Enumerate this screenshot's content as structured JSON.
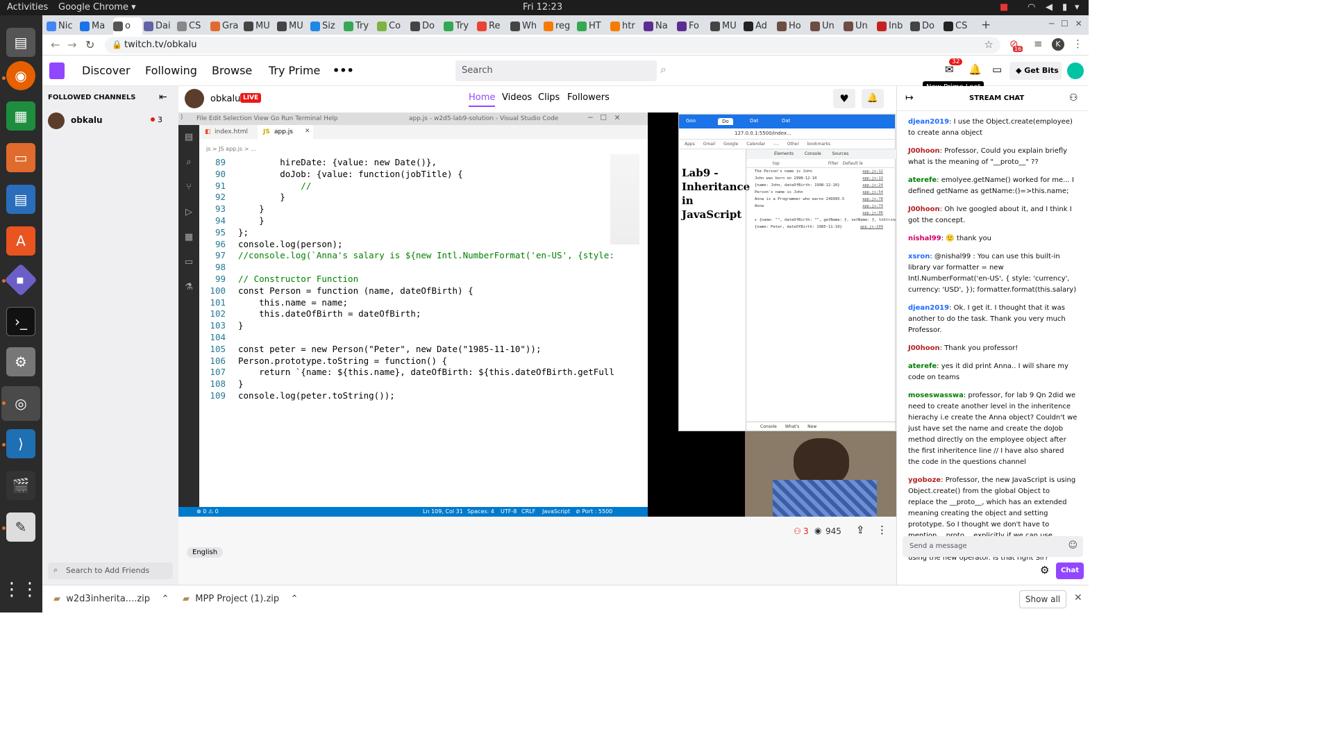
{
  "os": {
    "activities": "Activities",
    "app_menu": "Google Chrome ▾",
    "clock": "Fri 12:23"
  },
  "browser": {
    "tabs": [
      "Nic",
      "Ma",
      "o",
      "Dai",
      "CS",
      "Gra",
      "MU",
      "MU",
      "Siz",
      "Try",
      "Co",
      "Do",
      "Try",
      "Re",
      "Wh",
      "reg",
      "HT",
      "htr",
      "Na",
      "Fo",
      "MU",
      "Ad",
      "Ho",
      "Un",
      "Un",
      "Inb",
      "Do",
      "CS"
    ],
    "url": "twitch.tv/obkalu",
    "profile_initial": "K",
    "ext_badge": "16"
  },
  "twitch": {
    "nav": {
      "discover": "Discover",
      "following": "Following",
      "browse": "Browse",
      "try_prime": "Try Prime",
      "more": "•••"
    },
    "search_placeholder": "Search",
    "notif_count": "32",
    "get_bits": "Get Bits",
    "tooltip": "New Prime Loot",
    "sidebar": {
      "title": "FOLLOWED CHANNELS",
      "channel": "obkalu",
      "viewers": "3",
      "search_friends": "Search to Add Friends"
    },
    "channel": {
      "name": "obkalu",
      "live": "LIVE",
      "tabs": [
        "Home",
        "Videos",
        "Clips",
        "Followers"
      ]
    },
    "stats": {
      "viewers": "3",
      "views": "945"
    },
    "tag": "English",
    "chat": {
      "title": "STREAM CHAT",
      "send_placeholder": "Send a message",
      "chat_button": "Chat",
      "messages": [
        {
          "user": "djean2019",
          "color": "#1e69ff",
          "text": "I use the Object.create(employee) to create anna object"
        },
        {
          "user": "J00hoon",
          "color": "#b22222",
          "text": "Professor, Could you explain briefly what is the meaning of \"__proto__\" ??"
        },
        {
          "user": "aterefe",
          "color": "#008000",
          "text": "emolyee.getName() worked for me... I defined getName as getName:()=>this.name;"
        },
        {
          "user": "J00hoon",
          "color": "#b22222",
          "text": "Oh Ive googled about it, and I think I got the concept."
        },
        {
          "user": "nishal99",
          "color": "#d4006a",
          "text": "🙂 thank you"
        },
        {
          "user": "xsron",
          "color": "#1e69ff",
          "text": "@nishal99 : You can use this built-in library var formatter = new Intl.NumberFormat('en-US', { style: 'currency', currency: 'USD', }); formatter.format(this.salary)"
        },
        {
          "user": "djean2019",
          "color": "#1e69ff",
          "text": "Ok. I get it. I thought that it was another to do the task. Thank you very much Professor."
        },
        {
          "user": "J00hoon",
          "color": "#b22222",
          "text": "Thank you professor!"
        },
        {
          "user": "aterefe",
          "color": "#008000",
          "text": "yes it did print Anna.. I will share my code on teams"
        },
        {
          "user": "moseswasswa",
          "color": "#008000",
          "text": "professor, for lab 9 Qn 2did we need to create another level in the inheritence hierachy i.e create the Anna object? Couldn't we just have set the name and create the doJob method directly on the employee object after the first inheritence line // I have also shared the code in the questions channel"
        },
        {
          "user": "ygoboze",
          "color": "#b22222",
          "text": "Professor, the new JavaScript is using Object.create() from the global Object to replace the __proto__, which has an extended meaning creating the object and setting prototype. So I thought we don't have to mention __proto__ explicitly if we can use Object.create( ) or the constructor function using the new operator. Is that right Sir?"
        }
      ]
    }
  },
  "vscode": {
    "menu": [
      "File",
      "Edit",
      "Selection",
      "View",
      "Go",
      "Run",
      "Terminal",
      "Help"
    ],
    "title": "app.js - w2d5-lab9-solution - Visual Studio Code",
    "tabs": [
      "index.html",
      "app.js"
    ],
    "breadcrumb": "js > JS app.js > ...",
    "lines": [
      {
        "n": "89",
        "t": "        hireDate: {value: new Date()},"
      },
      {
        "n": "90",
        "t": "        doJob: {value: function(jobTitle) {"
      },
      {
        "n": "91",
        "t": "            //"
      },
      {
        "n": "92",
        "t": "        }"
      },
      {
        "n": "93",
        "t": "    }"
      },
      {
        "n": "94",
        "t": "    }"
      },
      {
        "n": "95",
        "t": "};"
      },
      {
        "n": "96",
        "t": "console.log(person);"
      },
      {
        "n": "97",
        "t": "//console.log(`Anna's salary is ${new Intl.NumberFormat('en-US', {style:"
      },
      {
        "n": "98",
        "t": ""
      },
      {
        "n": "99",
        "t": "// Constructor Function"
      },
      {
        "n": "100",
        "t": "const Person = function (name, dateOfBirth) {"
      },
      {
        "n": "101",
        "t": "    this.name = name;"
      },
      {
        "n": "102",
        "t": "    this.dateOfBirth = dateOfBirth;"
      },
      {
        "n": "103",
        "t": "}"
      },
      {
        "n": "104",
        "t": ""
      },
      {
        "n": "105",
        "t": "const peter = new Person(\"Peter\", new Date(\"1985-11-10\"));"
      },
      {
        "n": "106",
        "t": "Person.prototype.toString = function() {"
      },
      {
        "n": "107",
        "t": "    return `{name: ${this.name}, dateOfBirth: ${this.dateOfBirth.getFull"
      },
      {
        "n": "108",
        "t": "}"
      },
      {
        "n": "109",
        "t": "console.log(peter.toString());"
      }
    ],
    "status": {
      "errors": "⊗ 0 ⚠ 0",
      "position": "Ln 109, Col 31",
      "spaces": "Spaces: 4",
      "encoding": "UTF-8",
      "eol": "CRLF",
      "lang": "JavaScript",
      "port": "⊘ Port : 5500"
    }
  },
  "devtools": {
    "tabs": [
      "Goo",
      "Do",
      "Dat",
      "Dat"
    ],
    "url": "127.0.0.1:5500/index...",
    "bookmarks": [
      "Apps",
      "Gmail",
      "Google Calendar -...",
      "Other bookmarks"
    ],
    "page_heading": "Lab9 - Inheritance in JavaScript",
    "panel_tabs": [
      "Elements",
      "Console",
      "Sources"
    ],
    "context": "top",
    "filter": "Filter",
    "levels": "Default le",
    "console": [
      {
        "t": "The Person's name is John",
        "s": "app.js:12"
      },
      {
        "t": "John was born on 1998-12-10",
        "s": "app.js:13"
      },
      {
        "t": "{name: John, dateOfBirth: 1998-12-10}",
        "s": "app.js:24"
      },
      {
        "t": "Person's name is John",
        "s": "app.js:54"
      },
      {
        "t": "Anna is a Programmer who earns 249995.5",
        "s": "app.js:78"
      },
      {
        "t": "Anna",
        "s": "app.js:79"
      },
      {
        "t": "",
        "s": "app.js:96"
      },
      {
        "t": "▸ {name: \"\", dateOfBirth: \"\", getName: ƒ, setName: ƒ, toString: ƒ}",
        "s": ""
      },
      {
        "t": "{name: Peter, dateOfBirth: 1985-11-10}",
        "s": "app.js:109"
      }
    ],
    "drawer_tabs": [
      "Console",
      "What's New"
    ]
  },
  "downloads": {
    "items": [
      "w2d3inherita....zip",
      "MPP Project (1).zip"
    ],
    "show_all": "Show all"
  }
}
